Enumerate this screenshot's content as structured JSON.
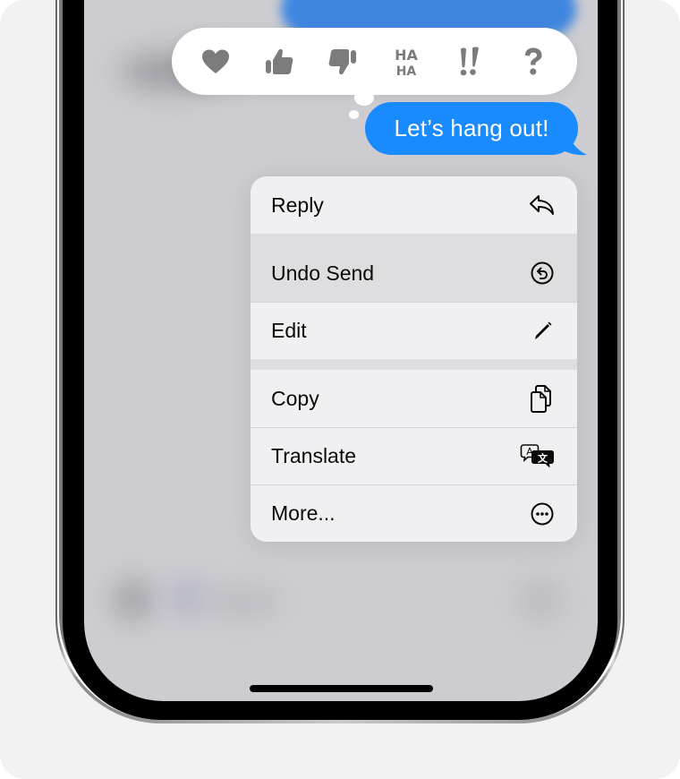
{
  "reactions": [
    {
      "name": "heart",
      "icon": "heart-icon"
    },
    {
      "name": "thumbs-up",
      "icon": "thumbs-up-icon"
    },
    {
      "name": "thumbs-down",
      "icon": "thumbs-down-icon"
    },
    {
      "name": "haha",
      "icon": "haha-icon",
      "text_top": "HA",
      "text_bottom": "HA"
    },
    {
      "name": "emphasize",
      "icon": "double-exclamation-icon",
      "text": "!!"
    },
    {
      "name": "question",
      "icon": "question-mark-icon",
      "text": "?"
    }
  ],
  "message": {
    "text": "Let’s hang out!",
    "color": "#1a8aff"
  },
  "menu": {
    "items": [
      {
        "label": "Reply",
        "icon": "reply-arrow-icon"
      },
      {
        "label": "Undo Send",
        "icon": "undo-circle-icon",
        "highlighted": true
      },
      {
        "label": "Edit",
        "icon": "pencil-icon"
      },
      {
        "label": "Copy",
        "icon": "copy-documents-icon"
      },
      {
        "label": "Translate",
        "icon": "translate-bubbles-icon"
      },
      {
        "label": "More...",
        "icon": "ellipsis-circle-icon"
      }
    ]
  },
  "colors": {
    "screen_background": "#cdccd1",
    "menu_background": "#f0f0f2",
    "highlight_row": "#dedee0",
    "reaction_icon": "#7c7c7c"
  }
}
